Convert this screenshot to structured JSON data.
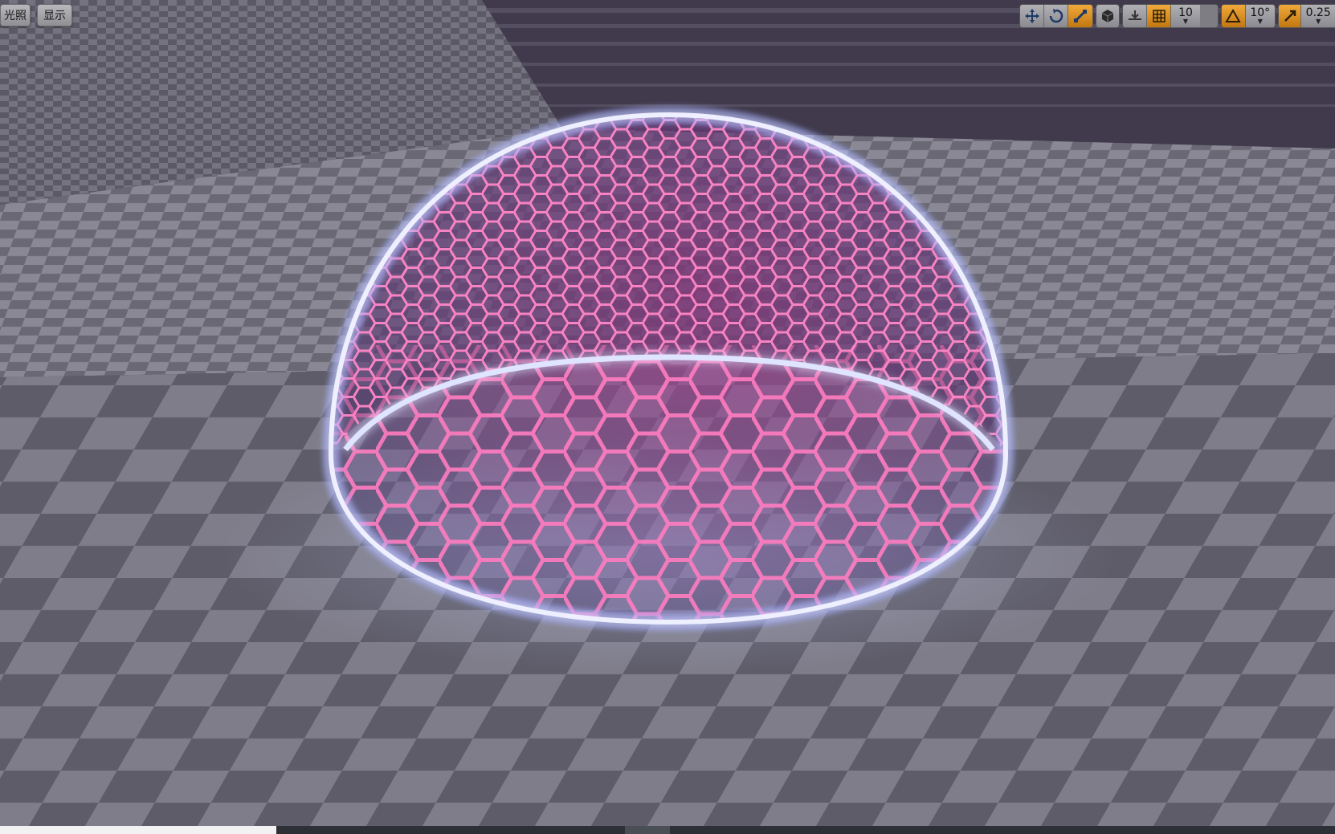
{
  "viewport": {
    "lighting_button": "光照",
    "show_button": "显示"
  },
  "toolbar": {
    "translate_icon": "translate-arrows-icon",
    "rotate_icon": "rotate-icon",
    "scale_icon": "scale-icon",
    "world_local_icon": "world-cube-icon",
    "surface_snap_icon": "surface-snap-icon",
    "grid_snap_icon": "grid-icon",
    "grid_snap_value": "10",
    "rotation_snap_icon": "angle-triangle-icon",
    "rotation_snap_value": "10°",
    "scale_snap_icon": "scale-arrow-icon",
    "scale_snap_value": "0.25"
  },
  "colors": {
    "accent_orange": "#e8951f",
    "hex_pink": "#ff6fb0",
    "rim_glow": "#cfd8ff",
    "floor_dark": "#5b5966",
    "floor_light": "#8e8c98"
  }
}
